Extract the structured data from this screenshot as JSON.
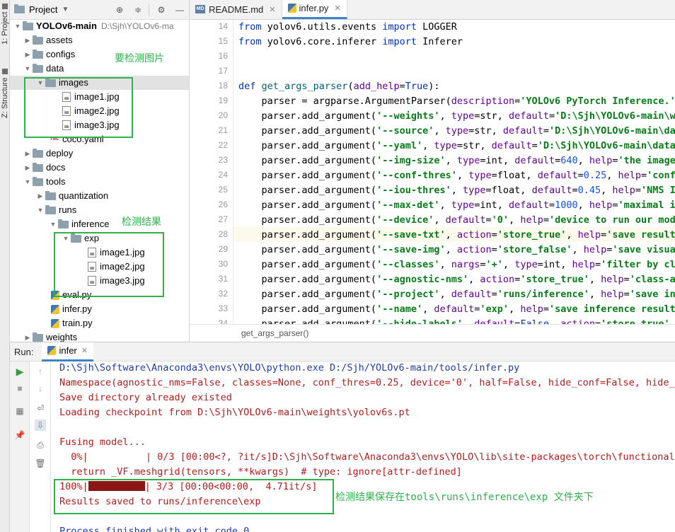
{
  "sidebar_tabs": {
    "project": "1: Project",
    "structure": "Z: Structure"
  },
  "project_panel": {
    "title": "Project",
    "root_name": "YOLOv6-main",
    "root_path": "D:\\Sjh\\YOLOv6-ma",
    "tree": [
      {
        "label": "assets"
      },
      {
        "label": "configs"
      },
      {
        "label": "data"
      },
      {
        "label": "images"
      },
      {
        "label": "image1.jpg"
      },
      {
        "label": "image2.jpg"
      },
      {
        "label": "image3.jpg"
      },
      {
        "label": "coco.yaml"
      },
      {
        "label": "deploy"
      },
      {
        "label": "docs"
      },
      {
        "label": "tools"
      },
      {
        "label": "quantization"
      },
      {
        "label": "runs"
      },
      {
        "label": "inference"
      },
      {
        "label": "exp"
      },
      {
        "label": "image1.jpg"
      },
      {
        "label": "image2.jpg"
      },
      {
        "label": "image3.jpg"
      },
      {
        "label": "eval.py"
      },
      {
        "label": "infer.py"
      },
      {
        "label": "train.py"
      },
      {
        "label": "weights"
      }
    ]
  },
  "annotations": {
    "images_note": "要检测图片",
    "result_note": "检测结果",
    "output_note": "检测结果保存在tools\\runs\\inference\\exp 文件夹下"
  },
  "editor": {
    "tabs": [
      {
        "label": "README.md",
        "icon": "MD"
      },
      {
        "label": "infer.py",
        "icon": "PY"
      }
    ],
    "breadcrumb": "get_args_parser()",
    "line_numbers": [
      "14",
      "15",
      "16",
      "17",
      "18",
      "19",
      "20",
      "21",
      "22",
      "23",
      "24",
      "25",
      "26",
      "27",
      "28",
      "29",
      "30",
      "31",
      "32",
      "33",
      "34"
    ]
  },
  "run_panel": {
    "label": "Run:",
    "tab": "infer",
    "output": [
      "D:\\Sjh\\Software\\Anaconda3\\envs\\YOLO\\python.exe D:/Sjh/YOLOv6-main/tools/infer.py",
      "Namespace(agnostic_nms=False, classes=None, conf_thres=0.25, device='0', half=False, hide_conf=False, hide_la",
      "Save directory already existed",
      "Loading checkpoint from D:\\Sjh\\YOLOv6-main\\weights\\yolov6s.pt",
      "",
      "Fusing model...",
      "  0%|          | 0/3 [00:00<?, ?it/s]D:\\Sjh\\Software\\Anaconda3\\envs\\YOLO\\lib\\site-packages\\torch\\functional.p",
      "  return _VF.meshgrid(tensors, **kwargs)  # type: ignore[attr-defined]",
      "| 3/3 [00:00<00:00,  4.71it/s]",
      "Results saved to runs/inference\\exp",
      "",
      "Process finished with exit code 0"
    ],
    "progress_prefix": "100%|",
    "progress_fraction": 1.0
  }
}
